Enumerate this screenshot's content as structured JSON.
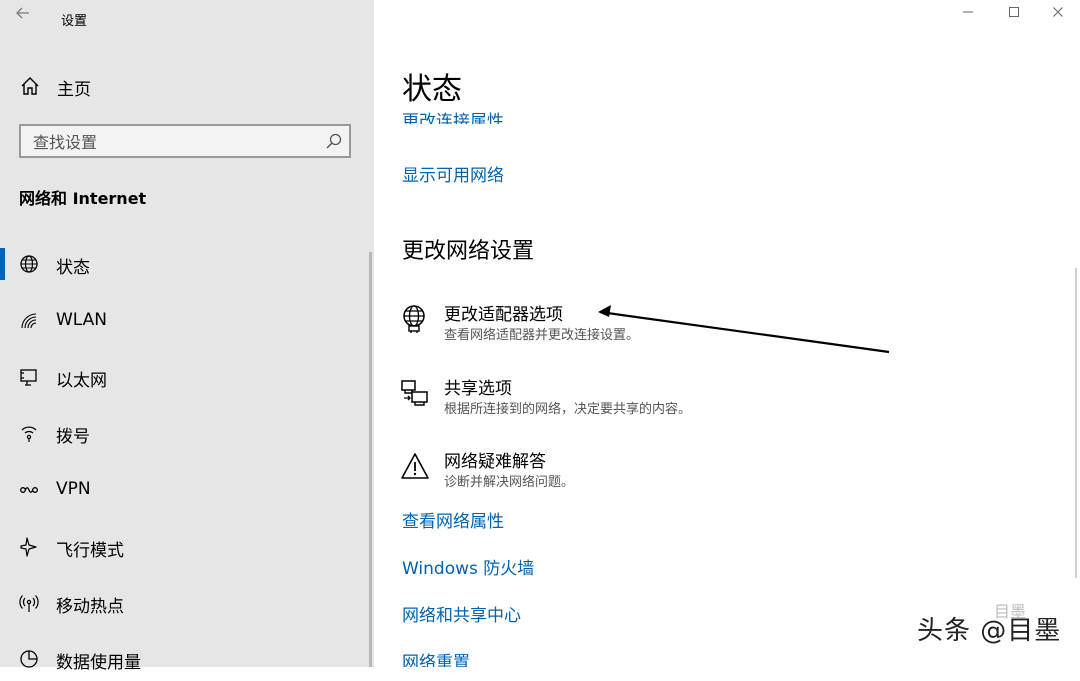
{
  "app": {
    "title": "设置"
  },
  "window_controls": {
    "minimize": "—",
    "maximize": "☐",
    "close": "✕"
  },
  "sidebar": {
    "home": "主页",
    "search_placeholder": "查找设置",
    "section_title": "网络和 Internet",
    "items": [
      {
        "label": "状态",
        "icon": "globe-icon",
        "selected": true
      },
      {
        "label": "WLAN",
        "icon": "wifi-icon",
        "selected": false
      },
      {
        "label": "以太网",
        "icon": "ethernet-icon",
        "selected": false
      },
      {
        "label": "拨号",
        "icon": "dialup-icon",
        "selected": false
      },
      {
        "label": "VPN",
        "icon": "vpn-icon",
        "selected": false
      },
      {
        "label": "飞行模式",
        "icon": "airplane-icon",
        "selected": false
      },
      {
        "label": "移动热点",
        "icon": "hotspot-icon",
        "selected": false
      },
      {
        "label": "数据使用量",
        "icon": "data-usage-icon",
        "selected": false
      }
    ]
  },
  "main": {
    "title": "状态",
    "cut_link": "更改连接属性",
    "show_networks": "显示可用网络",
    "change_settings_heading": "更改网络设置",
    "options": [
      {
        "title": "更改适配器选项",
        "desc": "查看网络适配器并更改连接设置。",
        "icon": "adapter-globe-icon"
      },
      {
        "title": "共享选项",
        "desc": "根据所连接到的网络，决定要共享的内容。",
        "icon": "sharing-icon"
      },
      {
        "title": "网络疑难解答",
        "desc": "诊断并解决网络问题。",
        "icon": "warning-icon"
      }
    ],
    "links": [
      "查看网络属性",
      "Windows 防火墙",
      "网络和共享中心",
      "网络重置"
    ]
  },
  "watermark": {
    "text": "头条 @目墨",
    "ghost": "目墨"
  },
  "colors": {
    "accent": "#0063b1",
    "sidebar_bg": "#e6e6e6",
    "main_bg": "#ffffff"
  }
}
